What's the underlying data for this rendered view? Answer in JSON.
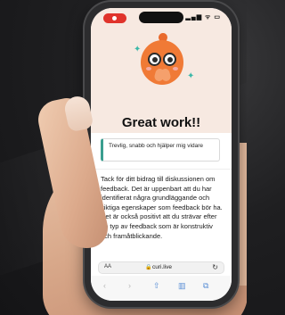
{
  "status_bar": {
    "icons": "▂▄▆ ᯤ ▭"
  },
  "hero": {
    "title": "Great work!!"
  },
  "quote": {
    "text": "Trevlig, snabb och hjälper mig vidare"
  },
  "feedback": {
    "text": "Tack för ditt bidrag till diskussionen om feedback. Det är uppenbart att du har identifierat några grundläggande och viktiga egenskaper som feedback bör ha. Det är också positivt att du strävar efter en typ av feedback som är konstruktiv och framåtblickande."
  },
  "browser": {
    "aa_label": "AA",
    "url": "curi.live",
    "reload_icon": "reload-icon"
  },
  "colors": {
    "accent_teal": "#3a9e8f",
    "mascot_orange": "#f07a36",
    "hero_bg": "#f7e9e1",
    "record_red": "#e0332b"
  }
}
